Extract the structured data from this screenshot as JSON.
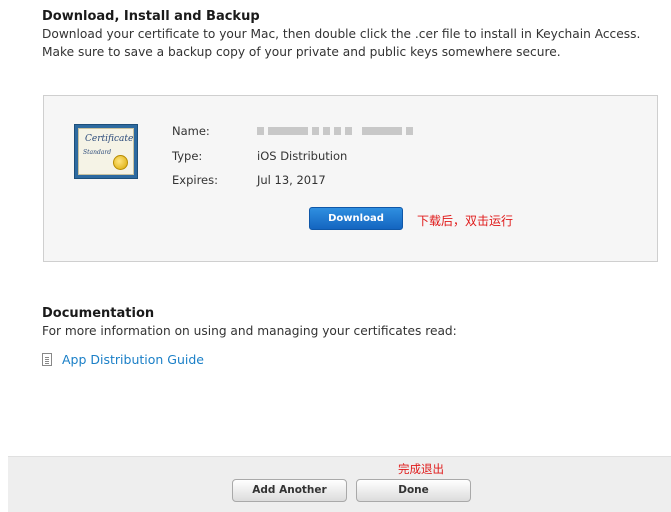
{
  "download_section": {
    "title": "Download, Install and Backup",
    "description": "Download your certificate to your Mac, then double click the .cer file to install in Keychain Access. Make sure to save a backup copy of your private and public keys somewhere secure."
  },
  "certificate": {
    "image_text_main": "Certificate",
    "image_text_sub": "Standard",
    "name_label": "Name:",
    "type_label": "Type:",
    "type_value": "iOS Distribution",
    "expires_label": "Expires:",
    "expires_value": "Jul 13, 2017",
    "download_label": "Download",
    "download_annotation": "下载后，双击运行"
  },
  "documentation": {
    "title": "Documentation",
    "description": "For more information on using and managing your certificates read:",
    "link_label": "App Distribution Guide"
  },
  "footer": {
    "done_annotation": "完成退出",
    "add_another_label": "Add Another",
    "done_label": "Done"
  },
  "colors": {
    "accent_blue": "#1a7fc7",
    "annotation_red": "#e01a1a"
  }
}
